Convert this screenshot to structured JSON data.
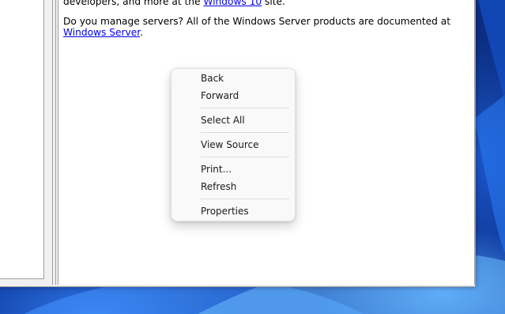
{
  "content": {
    "line1_prefix": "developers, and more at the ",
    "line1_link": "Windows 10",
    "line1_suffix": " site.",
    "para2_prefix": "Do you manage servers? All of the Windows Server products are documented at ",
    "para2_link": "Windows Server",
    "para2_suffix": "."
  },
  "context_menu": {
    "items": [
      {
        "label": "Back"
      },
      {
        "label": "Forward"
      },
      {
        "label": "Select All"
      },
      {
        "label": "View Source"
      },
      {
        "label": "Print..."
      },
      {
        "label": "Refresh"
      },
      {
        "label": "Properties"
      }
    ]
  },
  "colors": {
    "link": "#0000ee",
    "menu_bg": "#f9f9f9",
    "desktop_accent": "#0b2f86"
  }
}
